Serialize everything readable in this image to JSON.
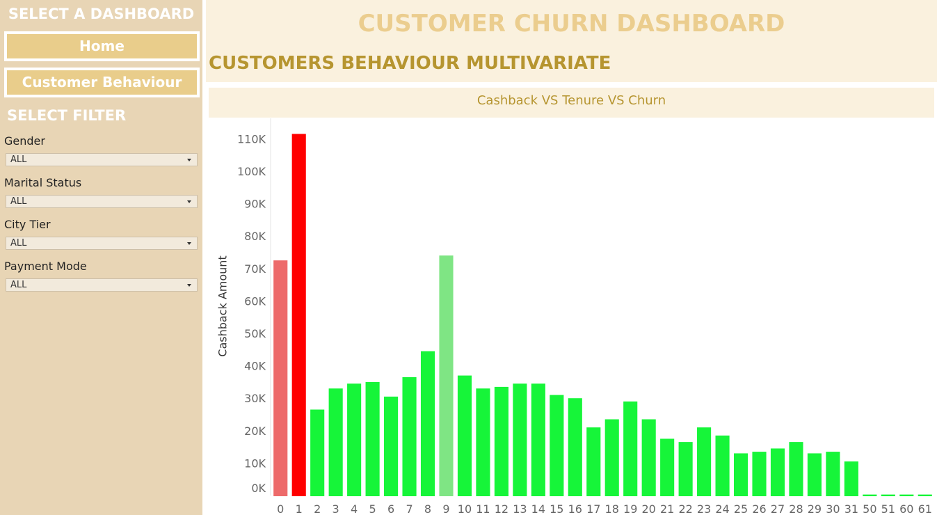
{
  "sidebar": {
    "title": "SELECT A DASHBOARD",
    "nav": [
      {
        "label": "Home"
      },
      {
        "label": "Customer Behaviour"
      }
    ],
    "filter_title": "SELECT FILTER",
    "filters": [
      {
        "label": "Gender",
        "value": "ALL"
      },
      {
        "label": "Marital Status",
        "value": "ALL"
      },
      {
        "label": "City Tier",
        "value": "ALL"
      },
      {
        "label": "Payment Mode",
        "value": "ALL"
      }
    ]
  },
  "header": {
    "title": "CUSTOMER CHURN DASHBOARD",
    "section": "CUSTOMERS BEHAVIOUR MULTIVARIATE"
  },
  "colors": {
    "sidebar_bg": "#e8d5b5",
    "header_bg": "#faf1de",
    "title_gold": "#ebcd8e",
    "section_gold": "#b69530"
  },
  "chart_data": {
    "type": "bar",
    "title": "Cashback VS Tenure VS Churn",
    "xlabel": "",
    "ylabel": "Cashback Amount",
    "ylim": [
      0,
      115000
    ],
    "y_ticks": [
      "0K",
      "10K",
      "20K",
      "30K",
      "40K",
      "50K",
      "60K",
      "70K",
      "80K",
      "90K",
      "100K",
      "110K"
    ],
    "categories": [
      "0",
      "1",
      "2",
      "3",
      "4",
      "5",
      "6",
      "7",
      "8",
      "9",
      "10",
      "11",
      "12",
      "13",
      "14",
      "15",
      "16",
      "17",
      "18",
      "19",
      "20",
      "21",
      "22",
      "23",
      "24",
      "25",
      "26",
      "27",
      "28",
      "29",
      "30",
      "31",
      "50",
      "51",
      "60",
      "61"
    ],
    "values": [
      72500,
      111500,
      26500,
      33000,
      34500,
      35000,
      30500,
      36500,
      44500,
      74000,
      37000,
      33000,
      33500,
      34500,
      34500,
      31000,
      30000,
      21000,
      23500,
      29000,
      23500,
      17500,
      16500,
      21000,
      18500,
      13000,
      13500,
      14500,
      16500,
      13000,
      13500,
      10500,
      300,
      300,
      300,
      300
    ],
    "bar_colors": [
      "#ed6a6a",
      "#ff0000",
      "#16f539",
      "#16f539",
      "#16f539",
      "#16f539",
      "#16f539",
      "#16f539",
      "#16f539",
      "#7fe584",
      "#16f539",
      "#16f539",
      "#16f539",
      "#16f539",
      "#16f539",
      "#16f539",
      "#16f539",
      "#16f539",
      "#16f539",
      "#16f539",
      "#16f539",
      "#16f539",
      "#16f539",
      "#16f539",
      "#16f539",
      "#16f539",
      "#16f539",
      "#16f539",
      "#16f539",
      "#16f539",
      "#16f539",
      "#16f539",
      "#16f539",
      "#16f539",
      "#16f539",
      "#16f539"
    ],
    "grid": false,
    "legend": "none"
  }
}
